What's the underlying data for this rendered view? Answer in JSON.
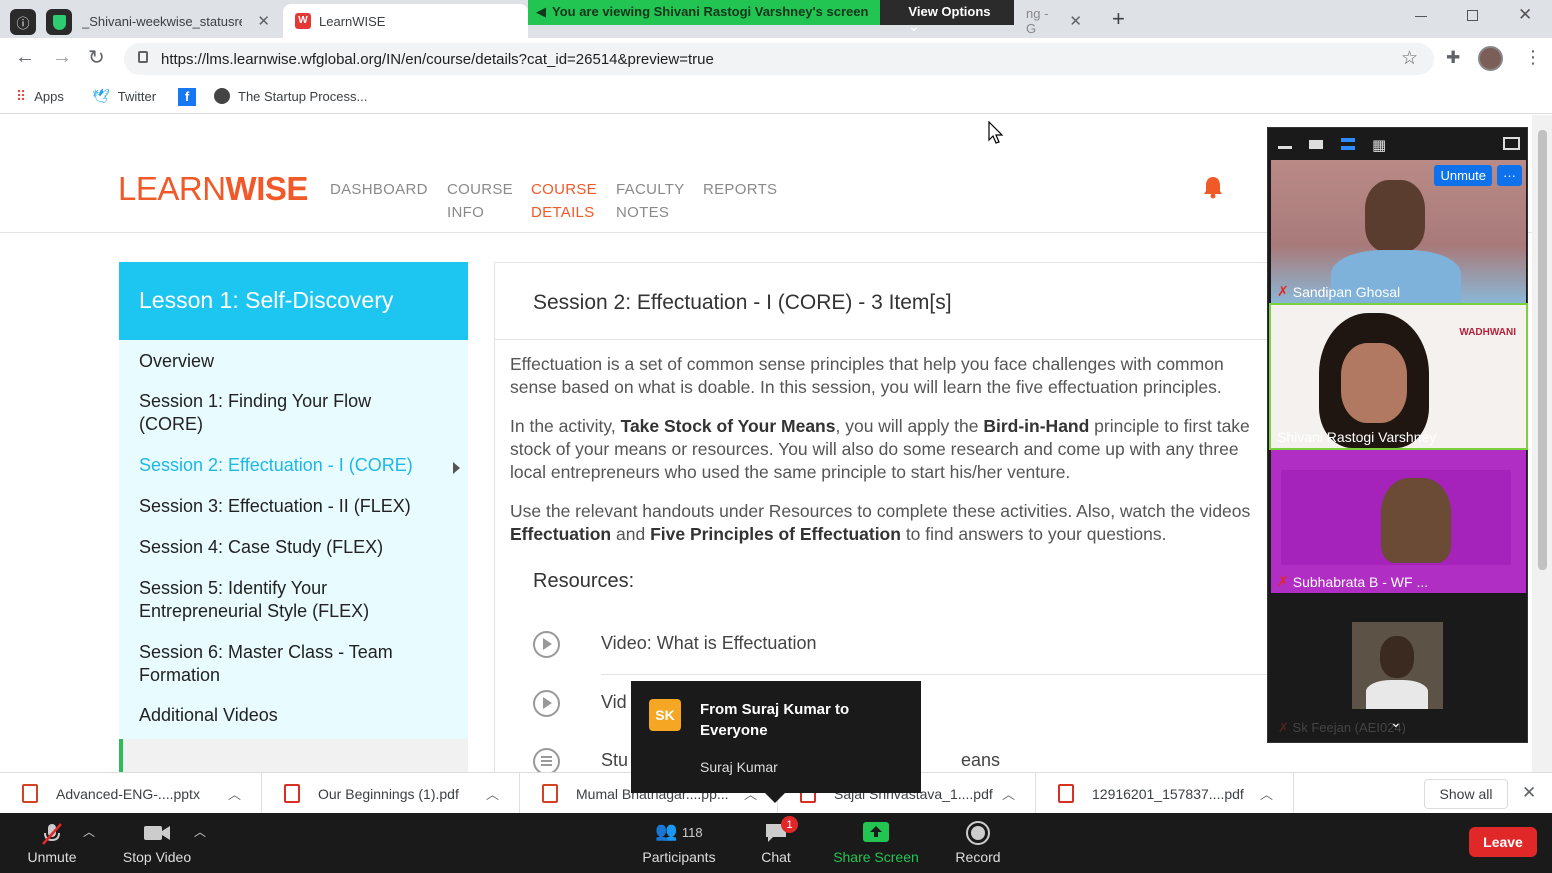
{
  "browser": {
    "tabs": [
      {
        "label": "_Shivani-weekwise_statusrep",
        "active": false
      },
      {
        "label": "LearnWISE",
        "active": true
      },
      {
        "label": "ng - G",
        "active": false
      }
    ],
    "url": "https://lms.learnwise.wfglobal.org/IN/en/course/details?cat_id=26514&preview=true",
    "bookmarks": [
      "Apps",
      "Twitter",
      "The Startup Process..."
    ]
  },
  "share_banner": {
    "message": "You are viewing Shivani Rastogi Varshney's screen",
    "view_options": "View Options"
  },
  "site": {
    "logo_light": "LEARN",
    "logo_bold": "WISE",
    "nav": [
      {
        "line1": "DASHBOARD",
        "line2": ""
      },
      {
        "line1": "COURSE",
        "line2": "INFO"
      },
      {
        "line1": "COURSE",
        "line2": "DETAILS"
      },
      {
        "line1": "FACULTY",
        "line2": "NOTES"
      },
      {
        "line1": "REPORTS",
        "line2": ""
      }
    ]
  },
  "lesson": {
    "title": "Lesson 1: Self-Discovery",
    "items": [
      "Overview",
      "Session 1: Finding Your Flow (CORE)",
      "Session 2: Effectuation - I (CORE)",
      "Session 3: Effectuation - II (FLEX)",
      "Session 4: Case Study (FLEX)",
      "Session 5: Identify Your Entrepreneurial Style (FLEX)",
      "Session 6: Master Class - Team Formation",
      "Additional Videos"
    ]
  },
  "session": {
    "heading": "Session 2: Effectuation - I (CORE) - 3 Item[s]",
    "p1": "Effectuation is a set of common sense principles that help you face challenges with common sense based on what is doable. In this session, you will learn the five effectuation principles.",
    "p2_a": "In the activity, ",
    "p2_b": "Take Stock of Your Means",
    "p2_c": ", you will apply the ",
    "p2_d": "Bird-in-Hand",
    "p2_e": " principle to first take stock of your means or resources. You will also do some research and come up with any three local entrepreneurs who used the same principle to start his/her venture.",
    "p3_a": "Use the relevant handouts under Resources to complete these activities. Also, watch the videos ",
    "p3_b": "Effectuation",
    "p3_c": " and ",
    "p3_d": "Five Principles of Effectuation",
    "p3_e": " to find answers to your questions.",
    "resources_label": "Resources:",
    "resources": [
      "Video: What is Effectuation",
      "Vid",
      "Stu",
      "eans"
    ]
  },
  "participants": [
    {
      "name": "Sandipan Ghosal",
      "muted": true
    },
    {
      "name": "Shivani Rastogi Varshney",
      "muted": false
    },
    {
      "name": "Subhabrata B - WF ...",
      "muted": true
    },
    {
      "name": "Sk Feejan (AEI024)",
      "muted": true
    }
  ],
  "video_controls": {
    "unmute": "Unmute",
    "more": "···"
  },
  "tile_logo": "WADHWANI",
  "chat_popup": {
    "initials": "SK",
    "from": "From Suraj Kumar to Everyone",
    "message": "Suraj Kumar"
  },
  "downloads": [
    "Advanced-ENG-....pptx",
    "Our Beginnings (1).pdf",
    "Mumal Bhatnagar....pp...",
    "Sajal Shrivastava_1....pdf",
    "12916201_157837....pdf"
  ],
  "downloads_show_all": "Show all",
  "zoom_toolbar": {
    "unmute": "Unmute",
    "stop_video": "Stop Video",
    "participants": "Participants",
    "participants_count": "118",
    "chat": "Chat",
    "chat_badge": "1",
    "share_screen": "Share Screen",
    "record": "Record",
    "leave": "Leave"
  },
  "colors": {
    "brand_orange": "#f05a28",
    "lesson_blue": "#1cc6f0",
    "zoom_green": "#23c552",
    "leave_red": "#e02828"
  }
}
